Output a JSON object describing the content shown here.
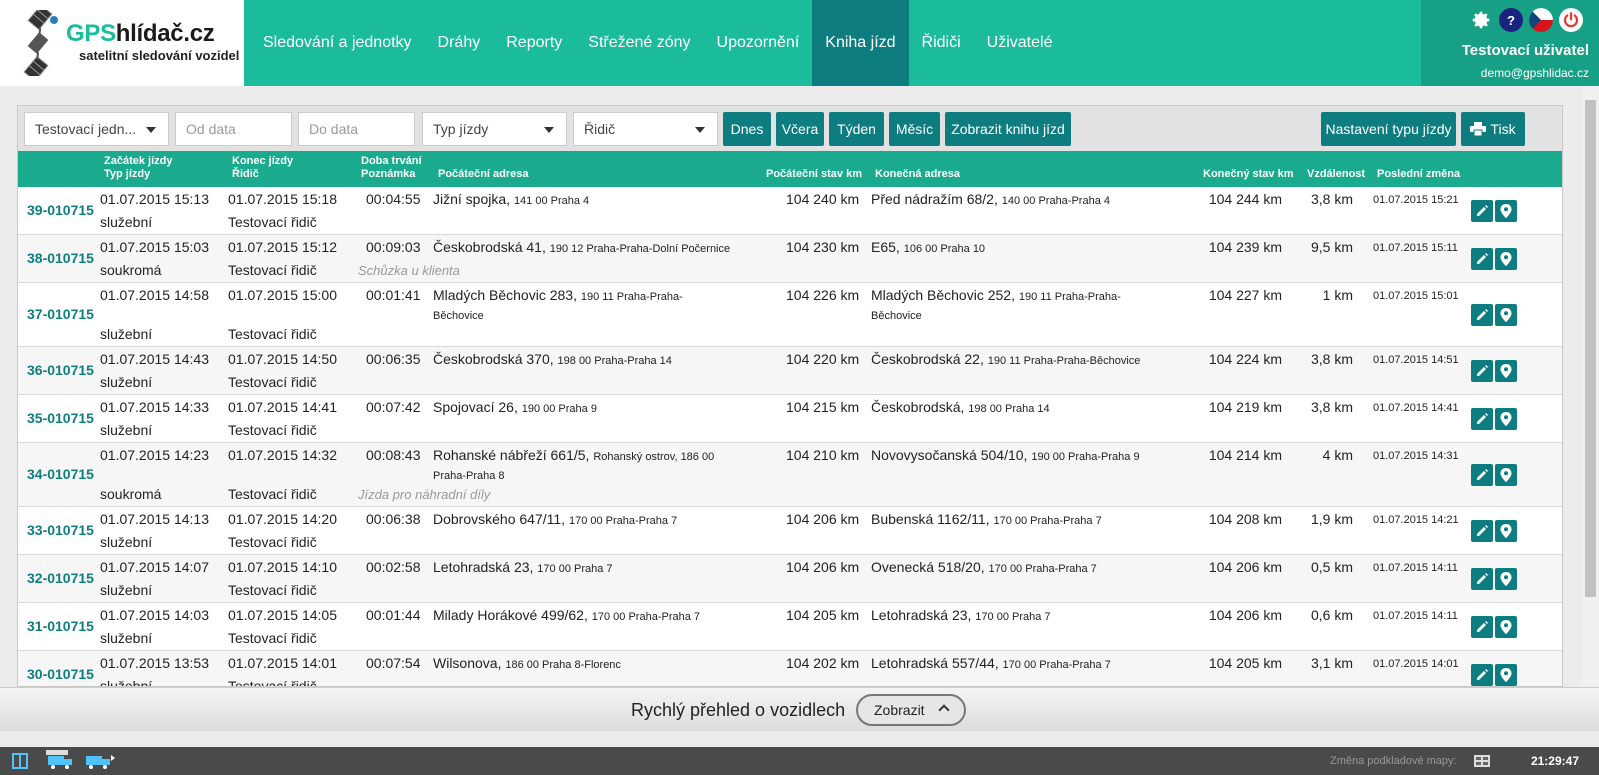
{
  "logo": {
    "title_gps": "GPS",
    "title_rest": "hlídač.cz",
    "subtitle": "satelitní sledování vozidel"
  },
  "nav": [
    {
      "label": "Sledování a jednotky",
      "active": false
    },
    {
      "label": "Dráhy",
      "active": false
    },
    {
      "label": "Reporty",
      "active": false
    },
    {
      "label": "Střežené zóny",
      "active": false
    },
    {
      "label": "Upozornění",
      "active": false
    },
    {
      "label": "Kniha jízd",
      "active": true
    },
    {
      "label": "Řidiči",
      "active": false
    },
    {
      "label": "Uživatelé",
      "active": false
    }
  ],
  "user": {
    "name": "Testovací uživatel",
    "email": "demo@gpshlidac.cz",
    "help": "?"
  },
  "filters": {
    "vehicle": "Testovací jedn...",
    "date_from_placeholder": "Od data",
    "date_to_placeholder": "Do data",
    "trip_type": "Typ jízdy",
    "driver": "Řidič"
  },
  "buttons": {
    "today": "Dnes",
    "yesterday": "Včera",
    "week": "Týden",
    "month": "Měsíc",
    "show_log": "Zobrazit knihu jízd",
    "trip_type_settings": "Nastavení typu jízdy",
    "print": "Tisk"
  },
  "columns": {
    "start_1": "Začátek jízdy",
    "start_2": "Typ jízdy",
    "end_1": "Konec jízdy",
    "end_2": "Řidič",
    "dur_1": "Doba trvání",
    "dur_2": "Poznámka",
    "start_addr": "Počáteční adresa",
    "start_km": "Počáteční stav km",
    "end_addr": "Konečná adresa",
    "end_km": "Konečný stav km",
    "distance": "Vzdálenost",
    "last_change": "Poslední změna"
  },
  "rows": [
    {
      "id": "39-010715",
      "start": "01.07.2015 15:13",
      "type": "služební",
      "end": "01.07.2015 15:18",
      "driver": "Testovací řidič",
      "duration": "00:04:55",
      "note": "",
      "start_addr": "Jižní spojka,",
      "start_addr_det": "141 00 Praha 4",
      "start_km": "104 240 km",
      "end_addr": "Před nádražím 68/2,",
      "end_addr_det": "140 00 Praha-Praha 4",
      "end_km": "104 244 km",
      "distance": "3,8 km",
      "last_change": "01.07.2015 15:21",
      "tall": false
    },
    {
      "id": "38-010715",
      "start": "01.07.2015 15:03",
      "type": "soukromá",
      "end": "01.07.2015 15:12",
      "driver": "Testovací řidič",
      "duration": "00:09:03",
      "note": "Schůzka u klienta",
      "start_addr": "Českobrodská 41,",
      "start_addr_det": "190 12 Praha-Praha-Dolní Počernice",
      "start_km": "104 230 km",
      "end_addr": "E65,",
      "end_addr_det": "106 00 Praha 10",
      "end_km": "104 239 km",
      "distance": "9,5 km",
      "last_change": "01.07.2015 15:11",
      "tall": false
    },
    {
      "id": "37-010715",
      "start": "01.07.2015 14:58",
      "type": "služební",
      "end": "01.07.2015 15:00",
      "driver": "Testovací řidič",
      "duration": "00:01:41",
      "note": "",
      "start_addr": "Mladých Běchovic 283,",
      "start_addr_det": "190 11 Praha-Praha-Běchovice",
      "start_km": "104 226 km",
      "end_addr": "Mladých Běchovic 252,",
      "end_addr_det": "190 11 Praha-Praha-Běchovice",
      "end_km": "104 227 km",
      "distance": "1 km",
      "last_change": "01.07.2015 15:01",
      "tall": true
    },
    {
      "id": "36-010715",
      "start": "01.07.2015 14:43",
      "type": "služební",
      "end": "01.07.2015 14:50",
      "driver": "Testovací řidič",
      "duration": "00:06:35",
      "note": "",
      "start_addr": "Českobrodská 370,",
      "start_addr_det": "198 00 Praha-Praha 14",
      "start_km": "104 220 km",
      "end_addr": "Českobrodská 22,",
      "end_addr_det": "190 11 Praha-Praha-Běchovice",
      "end_km": "104 224 km",
      "distance": "3,8 km",
      "last_change": "01.07.2015 14:51",
      "tall": false
    },
    {
      "id": "35-010715",
      "start": "01.07.2015 14:33",
      "type": "služební",
      "end": "01.07.2015 14:41",
      "driver": "Testovací řidič",
      "duration": "00:07:42",
      "note": "",
      "start_addr": "Spojovací 26,",
      "start_addr_det": "190 00 Praha 9",
      "start_km": "104 215 km",
      "end_addr": "Českobrodská,",
      "end_addr_det": "198 00 Praha 14",
      "end_km": "104 219 km",
      "distance": "3,8 km",
      "last_change": "01.07.2015 14:41",
      "tall": false
    },
    {
      "id": "34-010715",
      "start": "01.07.2015 14:23",
      "type": "soukromá",
      "end": "01.07.2015 14:32",
      "driver": "Testovací řidič",
      "duration": "00:08:43",
      "note": "Jízda pro náhradní díly",
      "start_addr": "Rohanské nábřeží 661/5,",
      "start_addr_det": "Rohanský ostrov, 186 00 Praha-Praha 8",
      "start_km": "104 210 km",
      "end_addr": "Novovysočanská 504/10,",
      "end_addr_det": "190 00 Praha-Praha 9",
      "end_km": "104 214 km",
      "distance": "4 km",
      "last_change": "01.07.2015 14:31",
      "tall": true
    },
    {
      "id": "33-010715",
      "start": "01.07.2015 14:13",
      "type": "služební",
      "end": "01.07.2015 14:20",
      "driver": "Testovací řidič",
      "duration": "00:06:38",
      "note": "",
      "start_addr": "Dobrovského 647/11,",
      "start_addr_det": "170 00 Praha-Praha 7",
      "start_km": "104 206 km",
      "end_addr": "Bubenská 1162/11,",
      "end_addr_det": "170 00 Praha-Praha 7",
      "end_km": "104 208 km",
      "distance": "1,9 km",
      "last_change": "01.07.2015 14:21",
      "tall": false
    },
    {
      "id": "32-010715",
      "start": "01.07.2015 14:07",
      "type": "služební",
      "end": "01.07.2015 14:10",
      "driver": "Testovací řidič",
      "duration": "00:02:58",
      "note": "",
      "start_addr": "Letohradská 23,",
      "start_addr_det": "170 00 Praha 7",
      "start_km": "104 206 km",
      "end_addr": "Ovenecká 518/20,",
      "end_addr_det": "170 00 Praha-Praha 7",
      "end_km": "104 206 km",
      "distance": "0,5 km",
      "last_change": "01.07.2015 14:11",
      "tall": false
    },
    {
      "id": "31-010715",
      "start": "01.07.2015 14:03",
      "type": "služební",
      "end": "01.07.2015 14:05",
      "driver": "Testovací řidič",
      "duration": "00:01:44",
      "note": "",
      "start_addr": "Milady Horákové 499/62,",
      "start_addr_det": "170 00 Praha-Praha 7",
      "start_km": "104 205 km",
      "end_addr": "Letohradská 23,",
      "end_addr_det": "170 00 Praha 7",
      "end_km": "104 206 km",
      "distance": "0,6 km",
      "last_change": "01.07.2015 14:11",
      "tall": false
    },
    {
      "id": "30-010715",
      "start": "01.07.2015 13:53",
      "type": "služební",
      "end": "01.07.2015 14:01",
      "driver": "Testovací řidič",
      "duration": "00:07:54",
      "note": "",
      "start_addr": "Wilsonova,",
      "start_addr_det": "186 00 Praha 8-Florenc",
      "start_km": "104 202 km",
      "end_addr": "Letohradská 557/44,",
      "end_addr_det": "170 00 Praha-Praha 7",
      "end_km": "104 205 km",
      "distance": "3,1 km",
      "last_change": "01.07.2015 14:01",
      "tall": false
    }
  ],
  "quickbar": {
    "text": "Rychlý přehled o vozidlech",
    "button": "Zobrazit"
  },
  "statusbar": {
    "map_label": "Změna podkladové mapy:",
    "time": "21:29:47"
  },
  "colors": {
    "primary": "#1abc9c",
    "dark": "#0e7d80",
    "user_bg": "#16a085"
  }
}
